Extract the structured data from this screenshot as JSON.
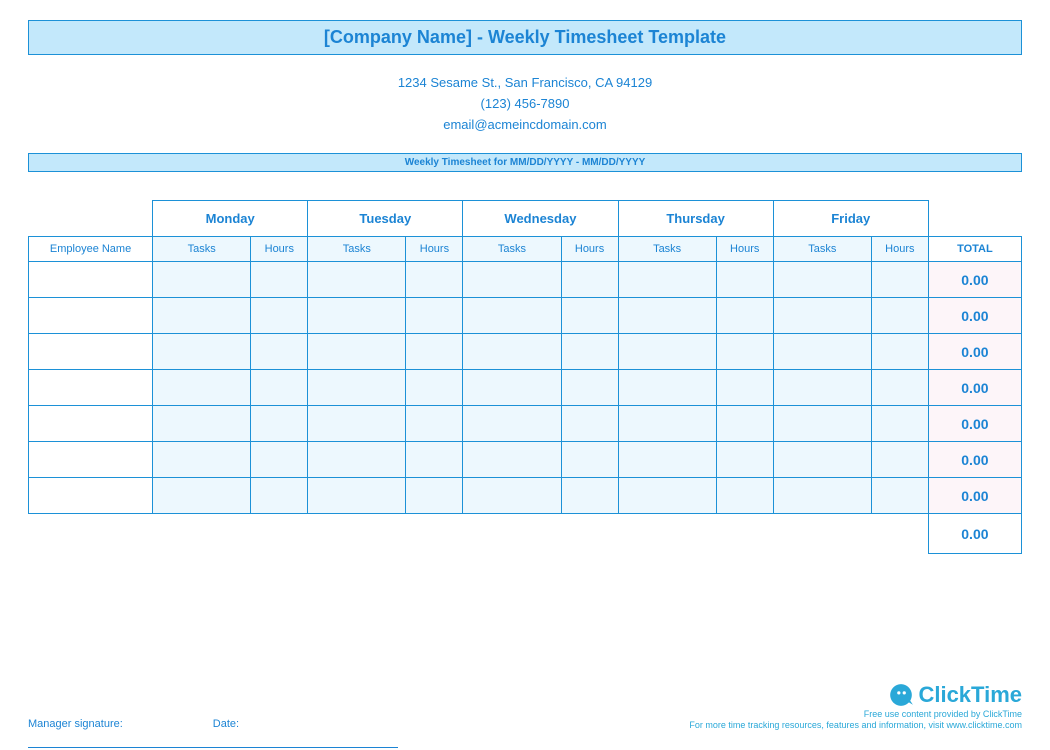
{
  "header": {
    "title": "[Company Name] - Weekly Timesheet Template",
    "address": "1234 Sesame St.,  San Francisco, CA 94129",
    "phone": "(123) 456-7890",
    "email": "email@acmeincdomain.com",
    "date_range": "Weekly Timesheet for MM/DD/YYYY - MM/DD/YYYY"
  },
  "columns": {
    "employee": "Employee Name",
    "days": [
      "Monday",
      "Tuesday",
      "Wednesday",
      "Thursday",
      "Friday"
    ],
    "tasks": "Tasks",
    "hours": "Hours",
    "total": "TOTAL"
  },
  "rows": [
    {
      "total": "0.00"
    },
    {
      "total": "0.00"
    },
    {
      "total": "0.00"
    },
    {
      "total": "0.00"
    },
    {
      "total": "0.00"
    },
    {
      "total": "0.00"
    },
    {
      "total": "0.00"
    }
  ],
  "grand_total": "0.00",
  "footer": {
    "signature_label": "Manager signature:",
    "date_label": "Date:",
    "brand_name": "ClickTime",
    "tag1": "Free use content provided by ClickTime",
    "tag2": "For more time tracking resources, features and information, visit www.clicktime.com"
  }
}
